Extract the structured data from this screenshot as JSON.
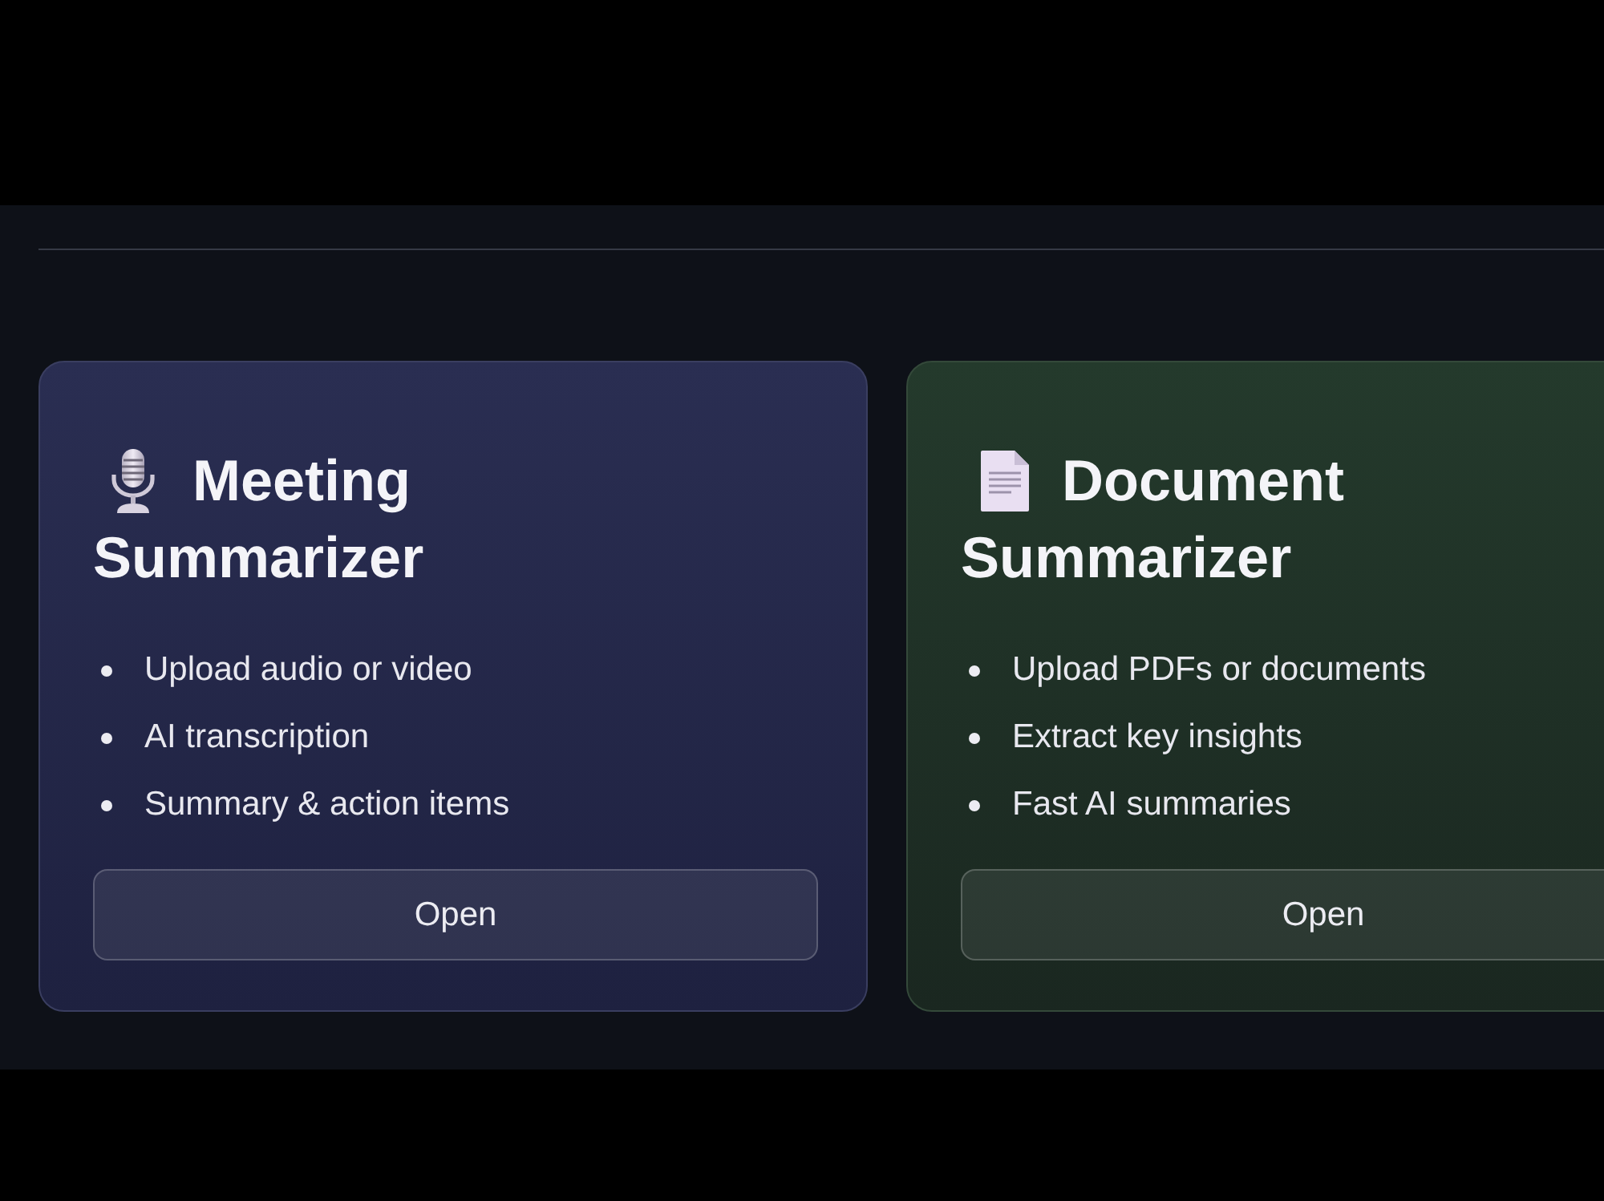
{
  "cards": [
    {
      "kind": "meeting",
      "title": "Meeting Summarizer",
      "features": [
        "Upload audio or video",
        "AI transcription",
        "Summary & action items"
      ],
      "button": "Open"
    },
    {
      "kind": "document",
      "title": "Document Summarizer",
      "features": [
        "Upload PDFs or documents",
        "Extract key insights",
        "Fast AI summaries"
      ],
      "button": "Open"
    }
  ]
}
